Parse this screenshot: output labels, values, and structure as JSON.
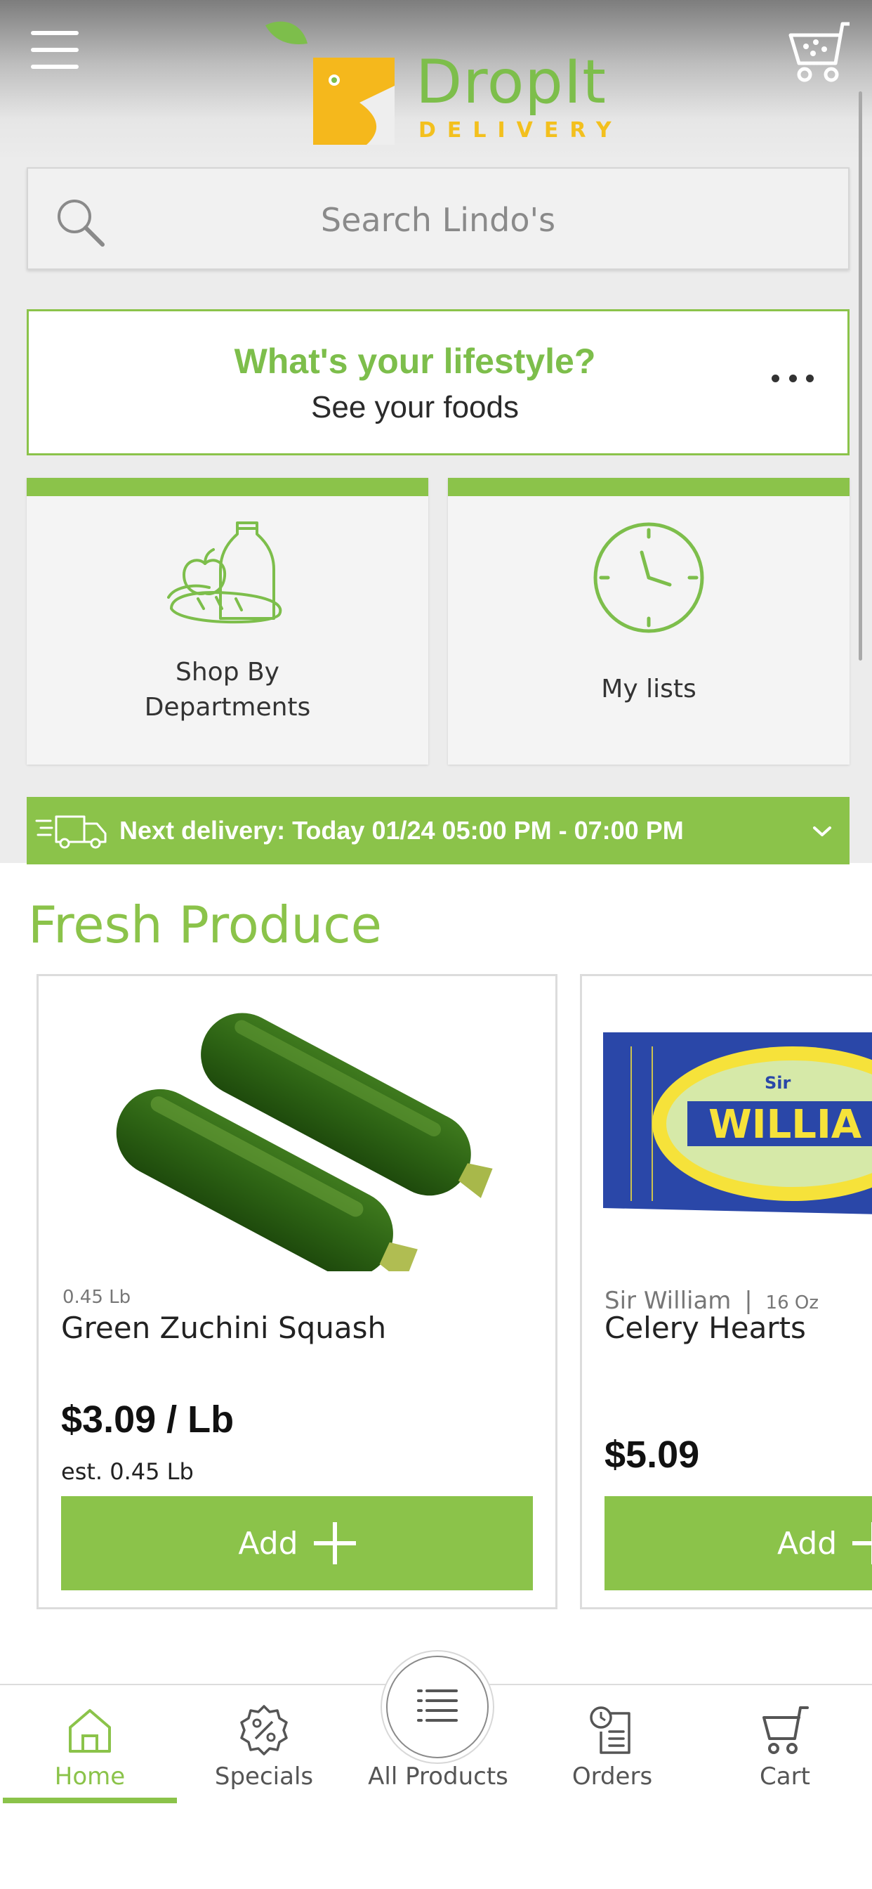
{
  "header": {
    "logo_word": "DropIt",
    "logo_sub": "DELIVERY",
    "menu_icon": "hamburger-menu-icon",
    "cart_icon": "shopping-cart-icon"
  },
  "search": {
    "placeholder": "Search Lindo's",
    "icon": "search-icon"
  },
  "lifestyle_banner": {
    "title": "What's your lifestyle?",
    "subtitle": "See your foods",
    "more_icon": "more-horizontal-icon"
  },
  "tiles": [
    {
      "label": "Shop By Departments",
      "line1": "Shop By",
      "line2": "Departments",
      "icon": "groceries-icon"
    },
    {
      "label": "My lists",
      "icon": "clock-icon"
    }
  ],
  "delivery": {
    "text": "Next delivery: Today 01/24 05:00 PM - 07:00 PM",
    "icon": "delivery-truck-icon",
    "chevron": "chevron-down-icon"
  },
  "section": {
    "title": "Fresh Produce"
  },
  "products": [
    {
      "brand": "",
      "size": "0.45 Lb",
      "name": "Green Zuchini Squash",
      "price": "$3.09 / Lb",
      "estimate": "est. 0.45 Lb",
      "add_label": "Add"
    },
    {
      "brand": "Sir William",
      "separator": "|",
      "size": "16 Oz",
      "name": "Celery Hearts",
      "price": "$5.09",
      "add_label": "Add"
    }
  ],
  "bottom_nav": [
    {
      "label": "Home",
      "icon": "home-icon",
      "active": true
    },
    {
      "label": "Specials",
      "icon": "percent-badge-icon",
      "active": false
    },
    {
      "label": "All Products",
      "icon": "list-icon",
      "active": false
    },
    {
      "label": "Orders",
      "icon": "orders-clock-icon",
      "active": false
    },
    {
      "label": "Cart",
      "icon": "cart-icon",
      "active": false
    }
  ],
  "colors": {
    "accent": "#8bc34a",
    "logo_green": "#7dbe4b",
    "logo_yellow": "#f3c01e",
    "background": "#ececec"
  }
}
